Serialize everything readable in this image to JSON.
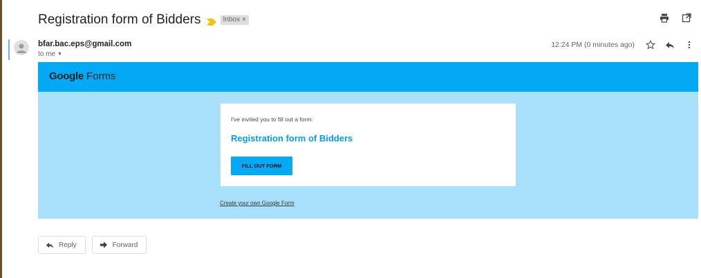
{
  "email": {
    "subject": "Registration form of Bidders",
    "label_chip": "Inbox",
    "label_remove": "×",
    "sender": "bfar.bac.eps@gmail.com",
    "to_line": "to me",
    "time": "12:24 PM (0 minutes ago)"
  },
  "form_email": {
    "brand_bold": "Google",
    "brand_rest": " Forms",
    "invite_text": "I've invited you to fill out a form:",
    "form_title": "Registration form of Bidders",
    "button_label": "FILL OUT FORM",
    "footer_link": "Create your own Google Form"
  },
  "actions": {
    "reply": "Reply",
    "forward": "Forward"
  },
  "icons": {
    "print": "print-icon",
    "popout": "open-in-new-window-icon",
    "star": "star-icon",
    "reply": "reply-icon",
    "more": "more-vert-icon",
    "importance": "importance-marker-icon",
    "avatar": "avatar-icon",
    "forward": "forward-icon"
  },
  "colors": {
    "forms_header": "#03a9f4",
    "forms_body": "#a8e0fb",
    "form_title": "#039be5",
    "importance": "#f4c20d"
  }
}
